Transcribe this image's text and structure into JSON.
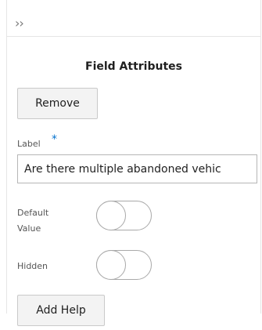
{
  "panel": {
    "collapse_icon": "double-chevron-right-icon",
    "collapse_glyph": "››",
    "title": "Field Attributes",
    "remove_label": "Remove",
    "label_field": {
      "label": "Label",
      "required_marker": "*",
      "value": "Are there multiple abandoned vehic"
    },
    "toggles": [
      {
        "label": "Default Value",
        "on": false
      },
      {
        "label": "Hidden",
        "on": false
      }
    ],
    "add_help_label": "Add Help"
  },
  "colors": {
    "accent": "#0572ce",
    "button_bg": "#f3f3f3",
    "border": "#c9c9c9"
  }
}
